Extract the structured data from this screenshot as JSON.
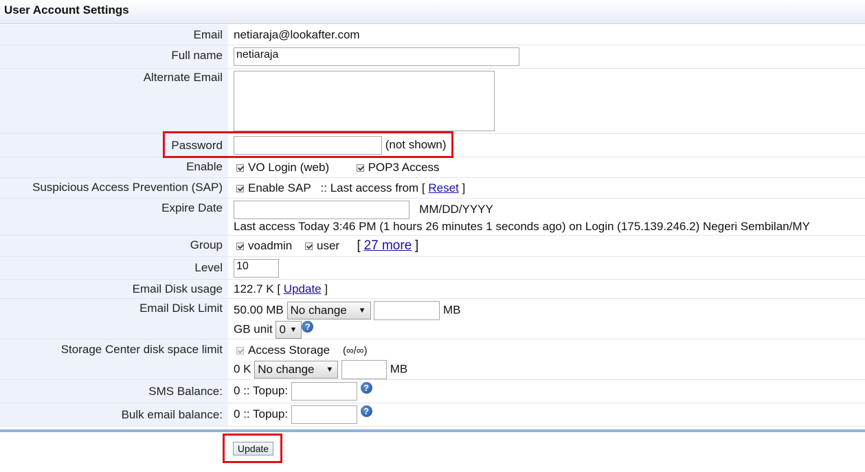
{
  "page": {
    "title": "User Account Settings"
  },
  "rows": {
    "email": {
      "label": "Email",
      "value": "netiaraja@lookafter.com"
    },
    "fullname": {
      "label": "Full name",
      "value": "netiaraja"
    },
    "altemail": {
      "label": "Alternate Email",
      "value": ""
    },
    "password": {
      "label": "Password",
      "value": "",
      "note": "(not shown)"
    },
    "enable": {
      "label": "Enable",
      "vo_login": "VO Login (web)",
      "pop3": "POP3 Access"
    },
    "sap": {
      "label": "Suspicious Access Prevention (SAP)",
      "enable_sap": "Enable SAP",
      "last_access_text": ":: Last access from [",
      "reset_link": "Reset",
      "close": "]"
    },
    "expire": {
      "label": "Expire Date",
      "value": "",
      "format": "MM/DD/YYYY",
      "last_access": "Last access Today 3:46 PM (1 hours 26 minutes 1 seconds ago) on Login (175.139.246.2) Negeri Sembilan/MY"
    },
    "group": {
      "label": "Group",
      "g1": "voadmin",
      "g2": "user",
      "open": "[",
      "more_link": "27 more",
      "close": "]"
    },
    "level": {
      "label": "Level",
      "value": "10"
    },
    "disk_usage": {
      "label": "Email Disk usage",
      "value": "122.7 K [",
      "update_link": "Update",
      "close": "]"
    },
    "disk_limit": {
      "label": "Email Disk Limit",
      "value": "50.00 MB",
      "select": "No change",
      "unit": "MB",
      "gb_label": "GB unit",
      "gb_select": "0"
    },
    "storage": {
      "label": "Storage Center disk space limit",
      "access": "Access Storage",
      "infinity": "(∞/∞)",
      "value": "0 K",
      "select": "No change",
      "unit": "MB"
    },
    "sms": {
      "label": "SMS Balance:",
      "value": "0 :: Topup:"
    },
    "bulk": {
      "label": "Bulk email balance:",
      "value": "0 :: Topup:"
    }
  },
  "actions": {
    "update_button": "Update"
  },
  "icons": {
    "help": "?",
    "dropdown": "▼"
  },
  "colors": {
    "highlight": "#e0101a",
    "link": "#1a0dab",
    "label_bg": "#eef2fa"
  }
}
